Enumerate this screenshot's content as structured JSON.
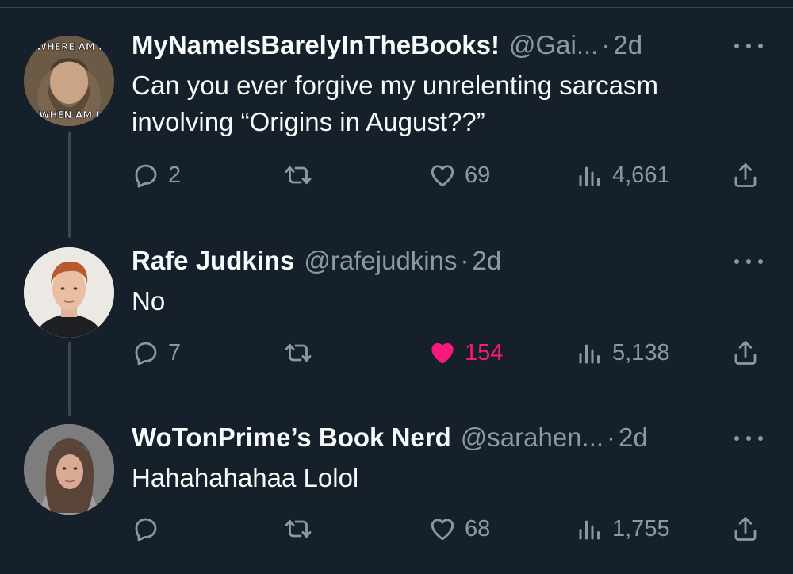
{
  "tweets": [
    {
      "name": "MyNameIsBarelyInTheBooks!",
      "handle": "@Gai...",
      "dot": "·",
      "time": "2d",
      "text": "Can you ever forgive my unrelenting sarcasm involving “Origins in August??”",
      "avatar_text_top": "WHERE AM I",
      "avatar_text_bottom": "WHEN AM I",
      "replies": "2",
      "retweets": "",
      "likes": "69",
      "views": "4,661",
      "liked": false
    },
    {
      "name": "Rafe Judkins",
      "handle": "@rafejudkins",
      "dot": "·",
      "time": "2d",
      "text": "No",
      "replies": "7",
      "retweets": "",
      "likes": "154",
      "views": "5,138",
      "liked": true
    },
    {
      "name": "WoTonPrime’s Book Nerd",
      "handle": "@sarahen...",
      "dot": "·",
      "time": "2d",
      "text": "Hahahahahaa Lolol",
      "replies": "",
      "retweets": "",
      "likes": "68",
      "views": "1,755",
      "liked": false
    }
  ],
  "colors": {
    "background": "#15202b",
    "secondary_text": "#8b98a5",
    "like_active": "#f91880"
  },
  "icons": [
    "reply-icon",
    "retweet-icon",
    "like-icon",
    "views-icon",
    "share-icon",
    "more-icon"
  ]
}
